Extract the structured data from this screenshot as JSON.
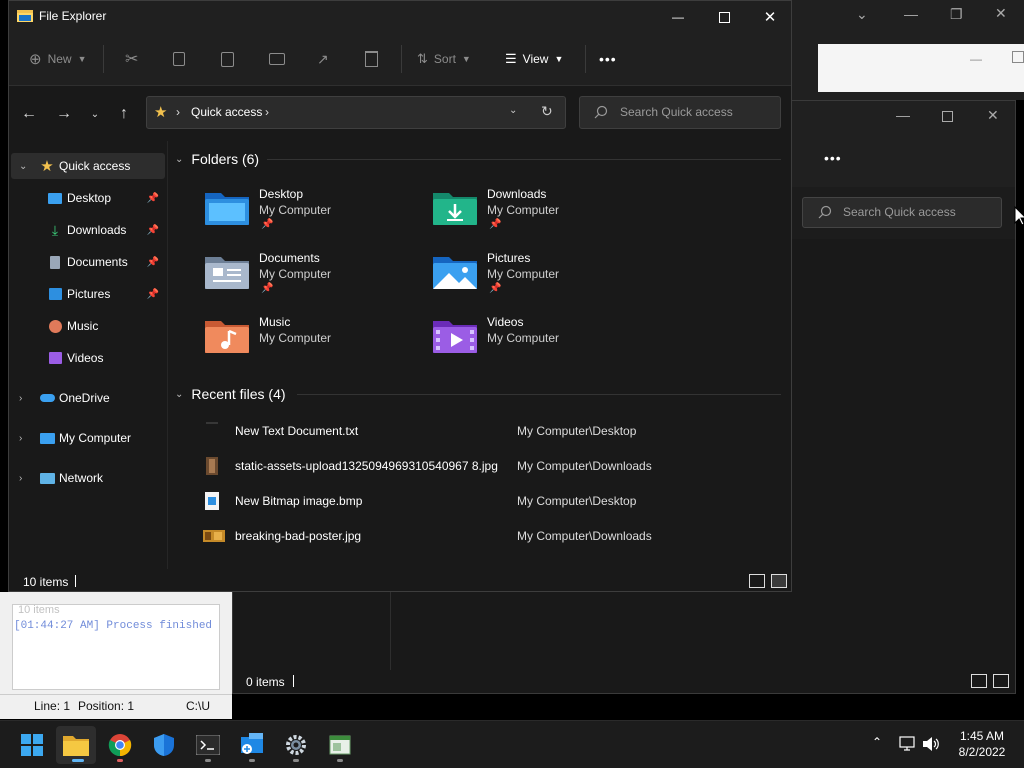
{
  "window": {
    "title": "File Explorer"
  },
  "toolbar": {
    "new_label": "New",
    "sort_label": "Sort",
    "view_label": "View",
    "more_label": "•••"
  },
  "address": {
    "location": "Quick access",
    "search_placeholder": "Search Quick access"
  },
  "sidebar": {
    "items": [
      {
        "label": "Quick access",
        "icon": "star-icon",
        "selected": true
      },
      {
        "label": "Desktop",
        "icon": "desktop-icon",
        "pinned": true
      },
      {
        "label": "Downloads",
        "icon": "download-icon",
        "pinned": true
      },
      {
        "label": "Documents",
        "icon": "document-icon",
        "pinned": true
      },
      {
        "label": "Pictures",
        "icon": "pictures-icon",
        "pinned": true
      },
      {
        "label": "Music",
        "icon": "music-icon"
      },
      {
        "label": "Videos",
        "icon": "videos-icon"
      },
      {
        "label": "OneDrive",
        "icon": "cloud-icon"
      },
      {
        "label": "My Computer",
        "icon": "computer-icon"
      },
      {
        "label": "Network",
        "icon": "network-icon"
      }
    ]
  },
  "folders": {
    "heading": "Folders (6)",
    "items": [
      {
        "name": "Desktop",
        "location": "My Computer",
        "pinned": true
      },
      {
        "name": "Downloads",
        "location": "My Computer",
        "pinned": true
      },
      {
        "name": "Documents",
        "location": "My Computer",
        "pinned": true
      },
      {
        "name": "Pictures",
        "location": "My Computer",
        "pinned": true
      },
      {
        "name": "Music",
        "location": "My Computer"
      },
      {
        "name": "Videos",
        "location": "My Computer"
      }
    ]
  },
  "recent": {
    "heading": "Recent files (4)",
    "items": [
      {
        "name": "New Text Document.txt",
        "location": "My Computer\\Desktop"
      },
      {
        "name": "static-assets-upload1325094969310540967 8.jpg",
        "location": "My Computer\\Downloads"
      },
      {
        "name": "New Bitmap image.bmp",
        "location": "My Computer\\Desktop"
      },
      {
        "name": "breaking-bad-poster.jpg",
        "location": "My Computer\\Downloads"
      }
    ]
  },
  "status": {
    "items_count": "10 items"
  },
  "background_window": {
    "search_placeholder": "Search Quick access",
    "status_count": "0 items",
    "more_label": "•••"
  },
  "console": {
    "ghost_text": "10 items",
    "log_line": "[01:44:27 AM] Process finished",
    "line_label": "Line: 1",
    "position_label": "Position: 1",
    "path_label": "C:\\U"
  },
  "taskbar": {
    "time": "1:45 AM",
    "date": "8/2/2022"
  },
  "colors": {
    "accent": "#0078d4",
    "window_bg": "#191919",
    "chrome_bg": "#202020",
    "folder_yellow": "#f2c14e"
  }
}
